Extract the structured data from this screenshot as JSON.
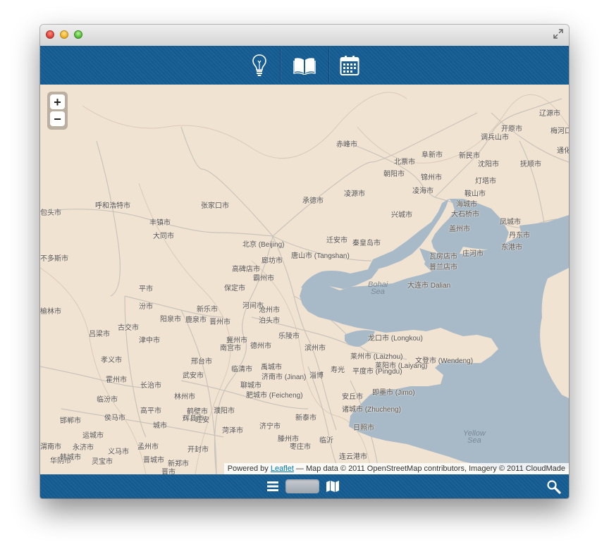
{
  "window": {
    "title": ""
  },
  "toolbar": {
    "buttons": [
      {
        "icon": "lightbulb-icon"
      },
      {
        "icon": "book-icon"
      },
      {
        "icon": "calendar-icon"
      }
    ]
  },
  "map": {
    "zoom_in": "+",
    "zoom_out": "−",
    "seas": [
      {
        "name1": "Bohai",
        "name2": "Sea"
      },
      {
        "name1": "Yellow",
        "name2": "Sea"
      }
    ],
    "labels": [
      "赤峰市",
      "北票市",
      "阜新市",
      "新民市",
      "开原市",
      "辽源市",
      "梅河口",
      "调兵山市",
      "沈阳市",
      "抚顺市",
      "通化",
      "朝阳市",
      "锦州市",
      "灯塔市",
      "凌源市",
      "凌海市",
      "鞍山市",
      "承德市",
      "海城市",
      "兴城市",
      "大石桥市",
      "盖州市",
      "凤城市",
      "丹东市",
      "包头市",
      "呼和浩特市",
      "张家口市",
      "丰镇市",
      "大同市",
      "北京 (Beijing)",
      "迁安市",
      "秦皇岛市",
      "唐山市 (Tangshan)",
      "廊坊市",
      "高碑店市",
      "霸州市",
      "保定市",
      "河间市",
      "新乐市",
      "沧州市",
      "泊头市",
      "阳泉市",
      "鹿泉市",
      "晋州市",
      "冀州市",
      "南宫市",
      "德州市",
      "乐陵市",
      "滨州市",
      "临清市",
      "禹城市",
      "济南市 (Jinan)",
      "聊城市",
      "肥城市 (Feicheng)",
      "邢台市",
      "武安市",
      "林州市",
      "鹤壁市",
      "濮阳市",
      "菏泽市",
      "济宁市",
      "滕州市",
      "枣庄市",
      "临沂",
      "日照市",
      "连云港市",
      "邯郸市",
      "长治市",
      "高平市",
      "辉县市",
      "开封市",
      "新郑市",
      "晋城市",
      "吕梁市",
      "古交市",
      "孝义市",
      "霍州市",
      "临汾市",
      "侯马市",
      "运城市",
      "永济市",
      "义马市",
      "灵宝市",
      "华阴市",
      "渭南市",
      "孟州市",
      "韩城市",
      "不多斯市",
      "榆林市",
      "瓦房店市",
      "普兰店市",
      "大连市 Dalian",
      "庄河市",
      "东港市",
      "龙口市 (Longkou)",
      "莱州市 (Laizhou)",
      "莱阳市 (Laiyang)",
      "文登市 (Wendeng)",
      "平度市 (Pingdu)",
      "即墨市 (Jimo)",
      "安丘市",
      "诸城市 (Zhucheng)",
      "寿光",
      "淄博",
      "新泰市",
      "平市",
      "汾市",
      "津中市",
      "城市",
      "旺安",
      "晋市"
    ],
    "attribution": {
      "prefix": "Powered by ",
      "link": "Leaflet",
      "suffix": " — Map data © 2011 OpenStreetMap contributors, Imagery © 2011 CloudMade"
    }
  },
  "bottombar": {
    "list_icon": "list-icon",
    "map_icon": "map-icon",
    "search_icon": "search-icon"
  },
  "colors": {
    "bar": "#165d93",
    "land": "#f1e3d2",
    "water": "#a8bac8"
  }
}
